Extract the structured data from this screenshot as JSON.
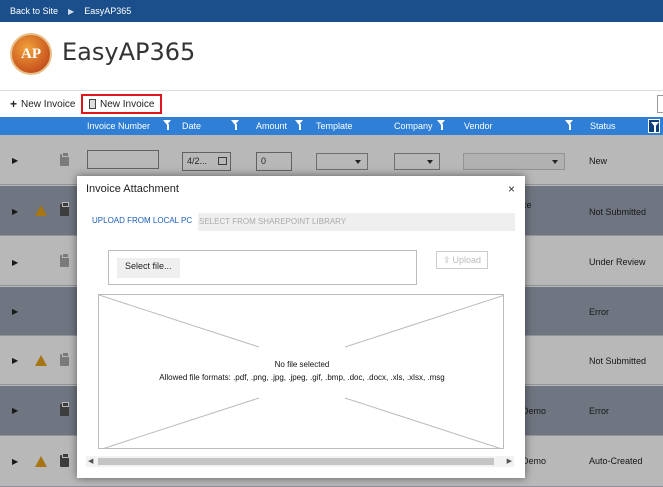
{
  "topbar": {
    "back": "Back to Site",
    "app": "EasyAP365"
  },
  "header": {
    "logo_text": "AP",
    "title": "EasyAP365"
  },
  "toolbar": {
    "new_invoice_1": "New Invoice",
    "new_invoice_2": "New Invoice"
  },
  "grid": {
    "columns": [
      "Invoice Number",
      "Date",
      "Amount",
      "Template",
      "Company",
      "Vendor",
      "Status"
    ],
    "filter_row": {
      "date": "4/2...",
      "amount": "0",
      "status": "New"
    },
    "rows": [
      {
        "status": "Not Submitted",
        "vendor": "ce",
        "warning": true
      },
      {
        "status": "Under Review",
        "vendor": "",
        "warning": false
      },
      {
        "status": "Error",
        "vendor": "",
        "warning": false
      },
      {
        "status": "Not Submitted",
        "vendor": "",
        "warning": true
      },
      {
        "status": "Error",
        "vendor": "Demo",
        "warning": false
      },
      {
        "status": "Auto-Created",
        "vendor": "Demo",
        "warning": true
      }
    ]
  },
  "modal": {
    "title": "Invoice Attachment",
    "close": "×",
    "tab_local": "UPLOAD FROM LOCAL PC",
    "tab_sharepoint": "SELECT FROM SHAREPOINT LIBRARY",
    "select_file": "Select file...",
    "upload": "Upload",
    "no_file": "No file selected",
    "allowed": "Allowed file formats: .pdf, .png, .jpg, .jpeg, .gif, .bmp, .doc, .docx, .xls, .xlsx, .msg"
  },
  "colors": {
    "topbar": "#1b4f8c",
    "grid_header": "#2f7fd6",
    "highlight": "#e0161b",
    "warning": "#e8a21a"
  }
}
